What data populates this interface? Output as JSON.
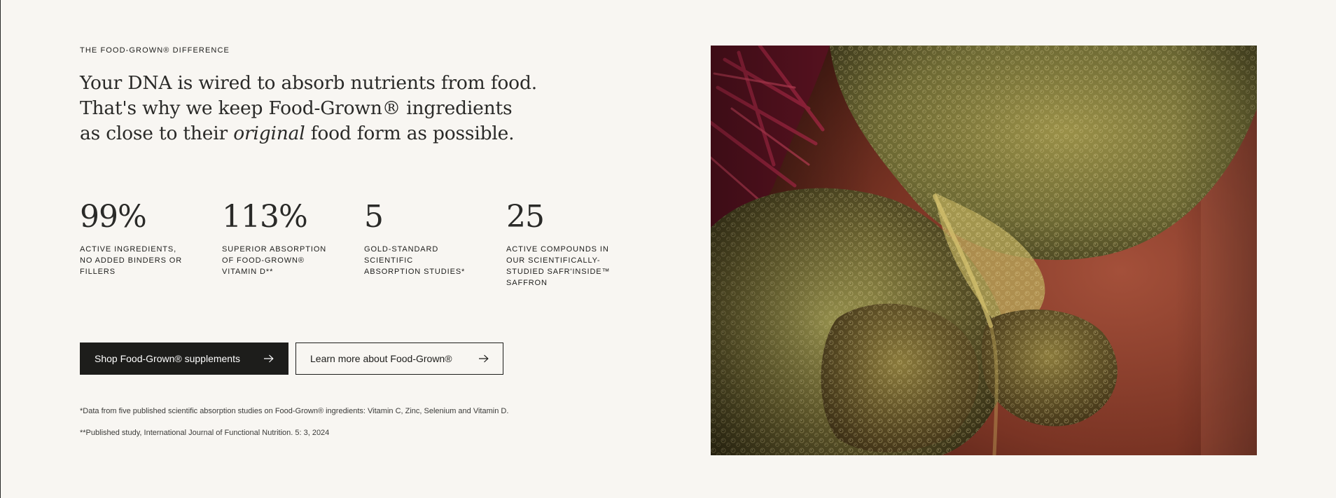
{
  "section": {
    "eyebrow": "THE FOOD-GROWN® DIFFERENCE",
    "headline": {
      "line1": "Your DNA is wired to absorb nutrients from food.",
      "line2": "That's why we keep Food-Grown® ingredients",
      "line3_before": "as close to their ",
      "line3_italic": "original",
      "line3_after": " food form as possible."
    }
  },
  "stats": [
    {
      "value": "99%",
      "label": "ACTIVE INGREDIENTS, NO ADDED BINDERS OR FILLERS"
    },
    {
      "value": "113%",
      "label": "SUPERIOR ABSORPTION OF FOOD-GROWN® VITAMIN D**"
    },
    {
      "value": "5",
      "label": "GOLD-STANDARD SCIENTIFIC ABSORPTION STUDIES*"
    },
    {
      "value": "25",
      "label": "ACTIVE COMPOUNDS IN OUR SCIENTIFICALLY-STUDIED SAFR'INSIDE™ SAFFRON"
    }
  ],
  "buttons": {
    "primary_label": "Shop Food-Grown® supplements",
    "secondary_label": "Learn more about Food-Grown®"
  },
  "footnotes": {
    "note1": "*Data from five published scientific absorption studies on Food-Grown® ingredients: Vitamin C, Zinc, Selenium and Vitamin D.",
    "note2": "**Published study, International Journal of Functional Nutrition. 5: 3, 2024"
  },
  "colors": {
    "background": "#f8f6f2",
    "text": "#1d1d1b",
    "primary_button": "#1d1d1b"
  },
  "icons": {
    "button_arrow": "arrow-right-icon"
  }
}
